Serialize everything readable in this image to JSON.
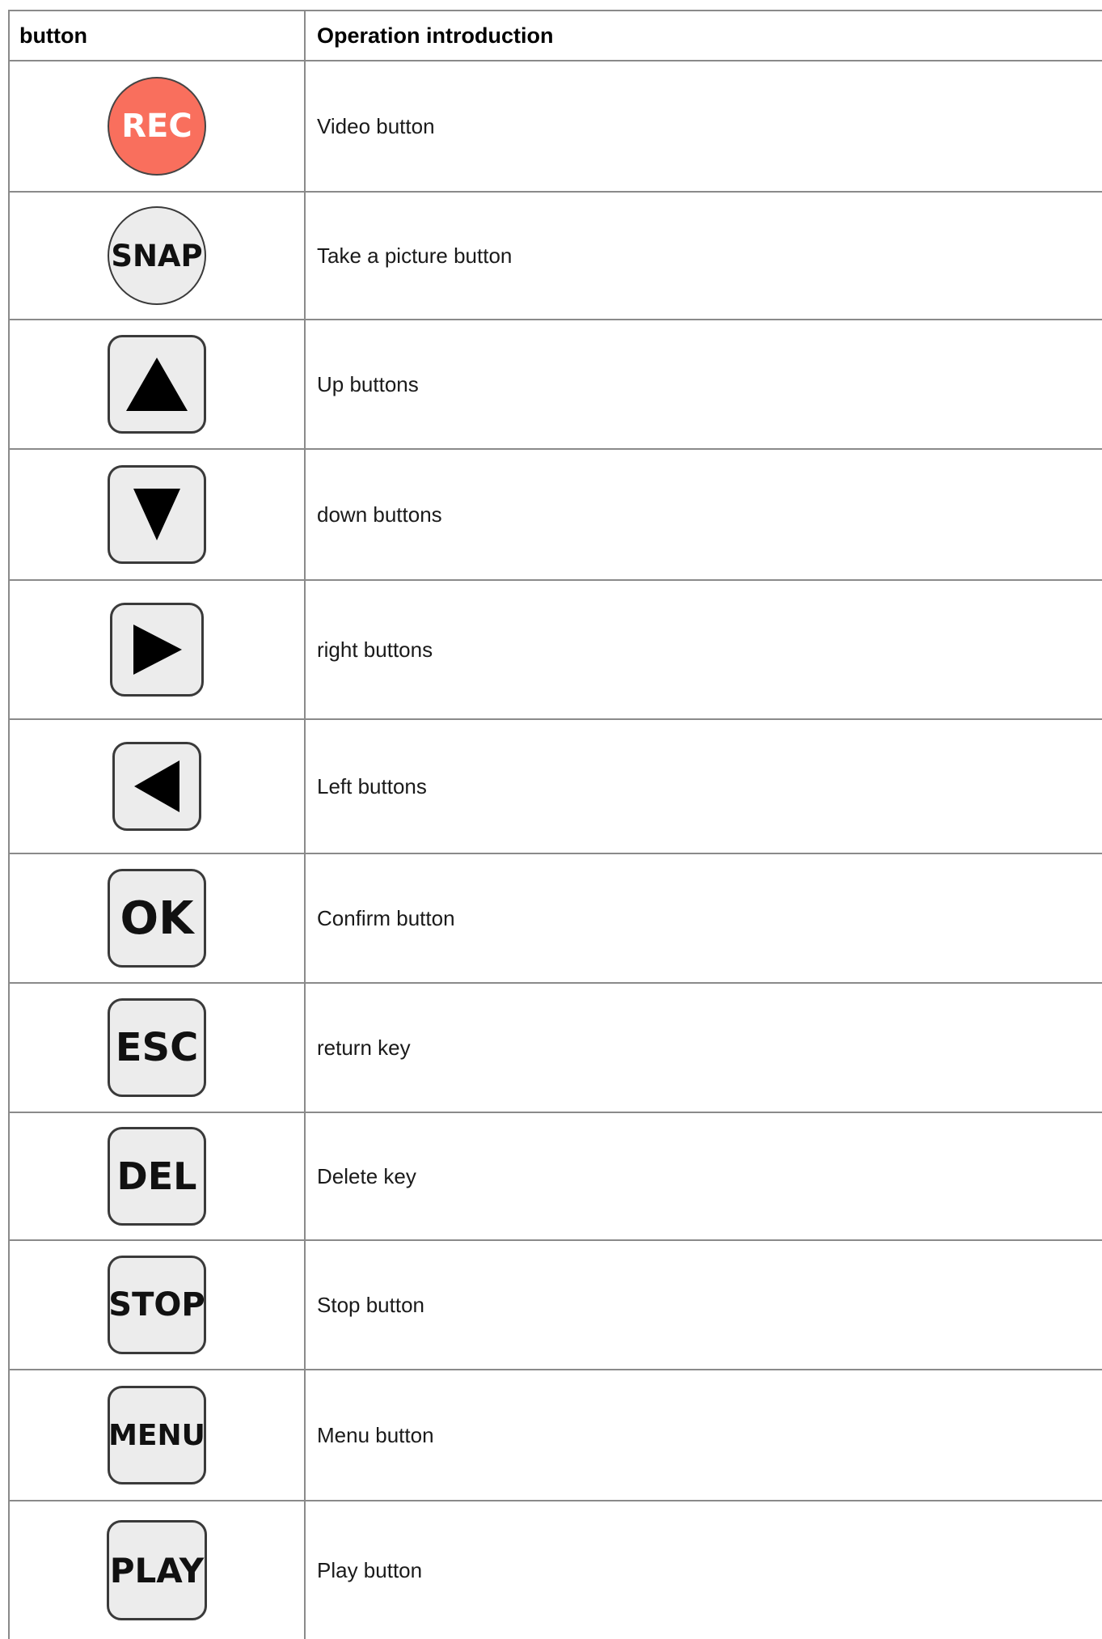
{
  "table": {
    "headers": {
      "button": "button",
      "operation": "Operation introduction"
    },
    "rows": [
      {
        "key_label": "REC",
        "icon": "rec-icon",
        "description": "Video button"
      },
      {
        "key_label": "SNAP",
        "icon": "snap-icon",
        "description": "Take a picture button"
      },
      {
        "key_label": "",
        "icon": "up-arrow-icon",
        "description": "Up buttons"
      },
      {
        "key_label": "",
        "icon": "down-arrow-icon",
        "description": "down buttons"
      },
      {
        "key_label": "",
        "icon": "right-arrow-icon",
        "description": "right buttons"
      },
      {
        "key_label": "",
        "icon": "left-arrow-icon",
        "description": "Left buttons"
      },
      {
        "key_label": "OK",
        "icon": "ok-icon",
        "description": "Confirm button"
      },
      {
        "key_label": "ESC",
        "icon": "esc-icon",
        "description": "return key"
      },
      {
        "key_label": "DEL",
        "icon": "del-icon",
        "description": "Delete key"
      },
      {
        "key_label": "STOP",
        "icon": "stop-icon",
        "description": "Stop button"
      },
      {
        "key_label": "MENU",
        "icon": "menu-icon",
        "description": "Menu button"
      },
      {
        "key_label": "PLAY",
        "icon": "play-icon",
        "description": "Play button"
      }
    ]
  },
  "colors": {
    "rec_fill": "#f96f5d",
    "key_fill": "#ececec",
    "border": "#8a8a8a"
  }
}
